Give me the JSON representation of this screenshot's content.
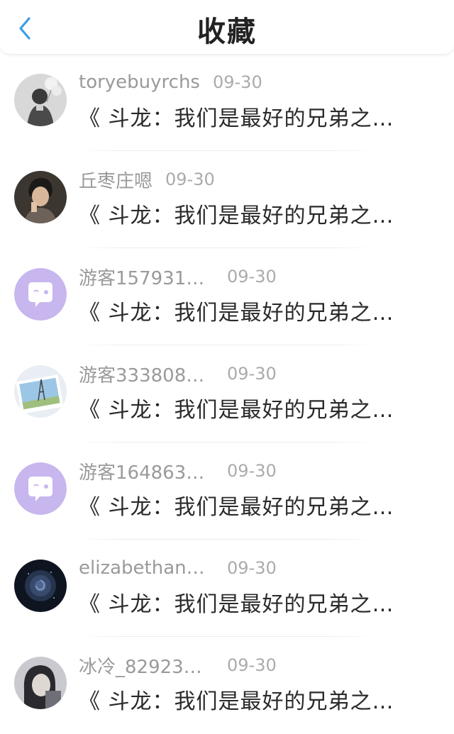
{
  "header": {
    "title": "收藏",
    "back_icon": "chevron-left-icon",
    "back_color": "#3a9ee8"
  },
  "items": [
    {
      "name": "toryebuyrchs",
      "date": "09-30",
      "text": "《 斗龙：我们是最好的兄弟之…",
      "avatar": "photo-girl-balloons"
    },
    {
      "name": "丘枣庄嗯",
      "date": "09-30",
      "text": "《 斗龙：我们是最好的兄弟之…",
      "avatar": "photo-boy"
    },
    {
      "name": "游客157931…",
      "date": "09-30",
      "text": "《 斗龙：我们是最好的兄弟之…",
      "avatar": "chat-bubble-avatar"
    },
    {
      "name": "游客333808…",
      "date": "09-30",
      "text": "《 斗龙：我们是最好的兄弟之…",
      "avatar": "eiffel-tower-photo"
    },
    {
      "name": "游客164863…",
      "date": "09-30",
      "text": "《 斗龙：我们是最好的兄弟之…",
      "avatar": "chat-bubble-avatar"
    },
    {
      "name": "elizabethan…",
      "date": "09-30",
      "text": "《 斗龙：我们是最好的兄弟之…",
      "avatar": "blue-rose-photo"
    },
    {
      "name": "冰冷_82923…",
      "date": "09-30",
      "text": "《 斗龙：我们是最好的兄弟之…",
      "avatar": "photo-girl"
    }
  ],
  "colors": {
    "avatar_purple": "#c8b6ee",
    "name_gray": "#9a9a9a",
    "date_gray": "#ababab",
    "text_dark": "#2a2a2a"
  }
}
